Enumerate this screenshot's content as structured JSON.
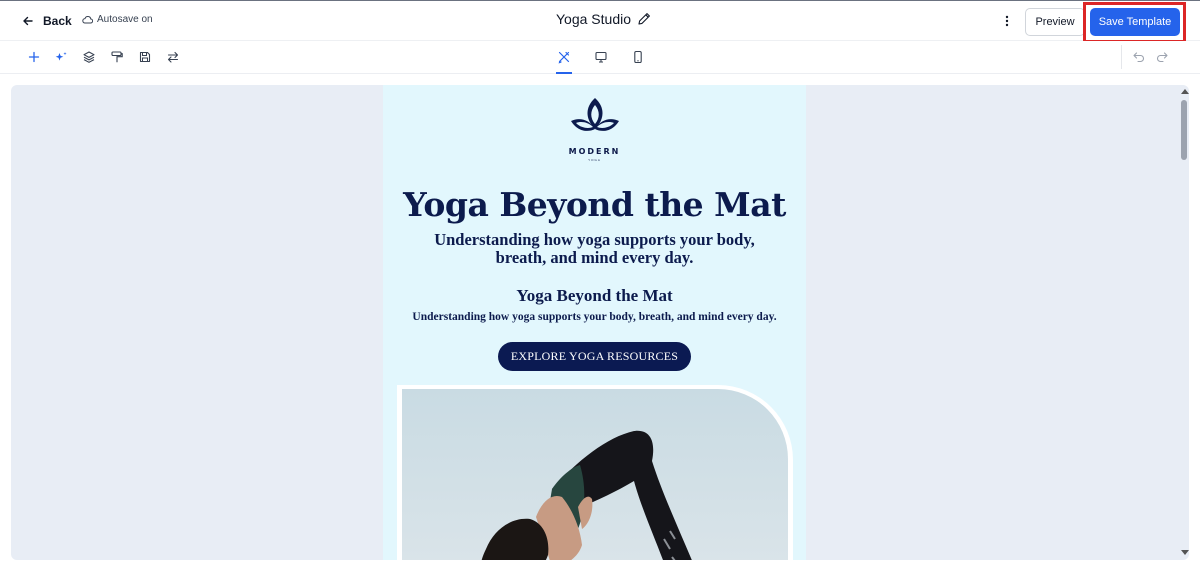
{
  "header": {
    "back_label": "Back",
    "autosave_label": "Autosave on",
    "title": "Yoga Studio",
    "preview_label": "Preview",
    "save_label": "Save Template"
  },
  "toolbar": {
    "left_icons": [
      "plus-icon",
      "sparkles-icon",
      "layers-icon",
      "paint-roller-icon",
      "save-disk-icon",
      "swap-arrows-icon"
    ],
    "view_icons": [
      "design-tools-icon",
      "desktop-icon",
      "mobile-icon"
    ],
    "active_view": "design-tools-icon",
    "right_icons": [
      "undo-icon",
      "redo-icon"
    ]
  },
  "email": {
    "logo_word": "MODERN",
    "logo_sub": "YOGA",
    "hero_title": "Yoga Beyond the Mat",
    "hero_subtitle": "Understanding how yoga supports your body, breath, and mind every day.",
    "section_title": "Yoga Beyond the Mat",
    "section_subtitle": "Understanding how yoga supports your body, breath, and mind every day.",
    "cta_label": "EXPLORE YOGA RESOURCES"
  },
  "colors": {
    "accent": "#2563eb",
    "highlight": "#dc2626",
    "email_bg": "#e2f7fd",
    "navy": "#0c1b4d",
    "canvas_bg": "#e8edf5"
  }
}
